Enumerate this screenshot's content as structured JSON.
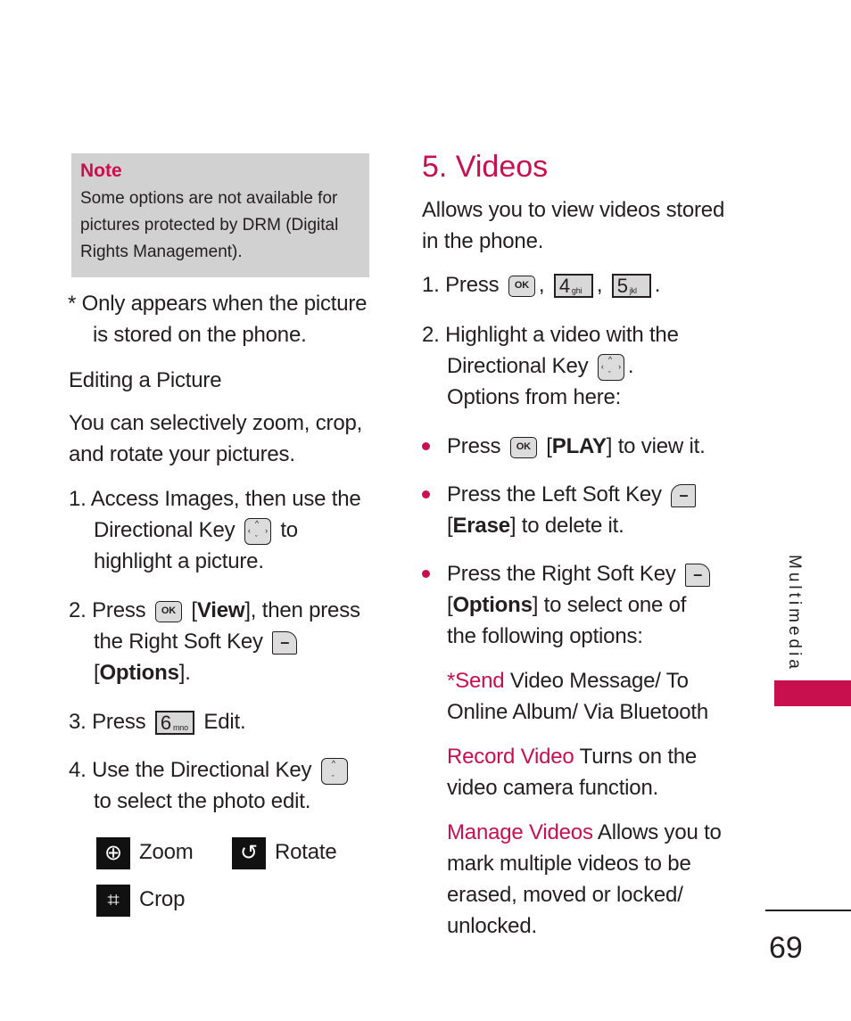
{
  "note": {
    "title": "Note",
    "body": "Some options are not available for pictures protected by DRM (Digital Rights Management)."
  },
  "left": {
    "footnote_line1": "* Only appears when the picture",
    "footnote_line2": "is stored on the phone.",
    "heading": "Editing a Picture",
    "intro_line1": "You can selectively zoom, crop,",
    "intro_line2": "and rotate your pictures.",
    "step1": {
      "num": "1.",
      "line1": "Access Images, then use the",
      "line2a": "Directional Key",
      "line2b": "to",
      "line3": "highlight a picture."
    },
    "step2": {
      "num": "2.",
      "a": "Press",
      "b": "[",
      "view": "View",
      "c": "], then press",
      "line2": "the Right Soft Key",
      "line3a": "[",
      "options": "Options",
      "line3b": "]."
    },
    "step3": {
      "num": "3.",
      "a": "Press",
      "b": "Edit."
    },
    "step4": {
      "num": "4.",
      "line1": "Use the Directional Key",
      "line2": "to select the photo edit."
    },
    "edit_options": [
      {
        "label": "Zoom",
        "icon": "zoom-icon"
      },
      {
        "label": "Rotate",
        "icon": "rotate-icon"
      },
      {
        "label": "Crop",
        "icon": "crop-icon"
      }
    ]
  },
  "keys": {
    "ok": "OK",
    "key4_digit": "4",
    "key4_letters": "ghi",
    "key5_digit": "5",
    "key5_letters": "jkl",
    "key6_digit": "6",
    "key6_letters": "mno",
    "soft": "–"
  },
  "right": {
    "title": "5. Videos",
    "intro_line1": "Allows you to view videos stored",
    "intro_line2": "in the phone.",
    "step1": {
      "num": "1.",
      "a": "Press",
      "comma": ",",
      "period": "."
    },
    "step2": {
      "num": "2.",
      "line1": "Highlight a video with the",
      "line2": "Directional Key",
      "line2end": ".",
      "line3": "Options from here:"
    },
    "bullet1": {
      "a": "Press",
      "b": "[",
      "play": "PLAY",
      "c": "] to view it."
    },
    "bullet2": {
      "line1": "Press the Left Soft Key",
      "a": "[",
      "erase": "Erase",
      "b": "] to delete it."
    },
    "bullet3": {
      "line1": "Press the Right Soft Key",
      "a": "[",
      "options": "Options",
      "b": "] to select one of",
      "line3": "the following options:"
    },
    "options": [
      {
        "term": "*Send",
        "line1": " Video Message/ To",
        "line2": "Online Album/ Via Bluetooth"
      },
      {
        "term": "Record Video",
        "line1": " Turns on the",
        "line2": "video camera function."
      },
      {
        "term": "Manage Videos",
        "line1": " Allows you to",
        "line2": "mark multiple videos to be",
        "line3": "erased, moved or locked/",
        "line4": "unlocked."
      }
    ]
  },
  "sidebar": {
    "section": "Multimedia"
  },
  "page_number": "69",
  "colors": {
    "accent": "#c8104f",
    "note_bg": "#d1d1d1",
    "text": "#231f20"
  }
}
